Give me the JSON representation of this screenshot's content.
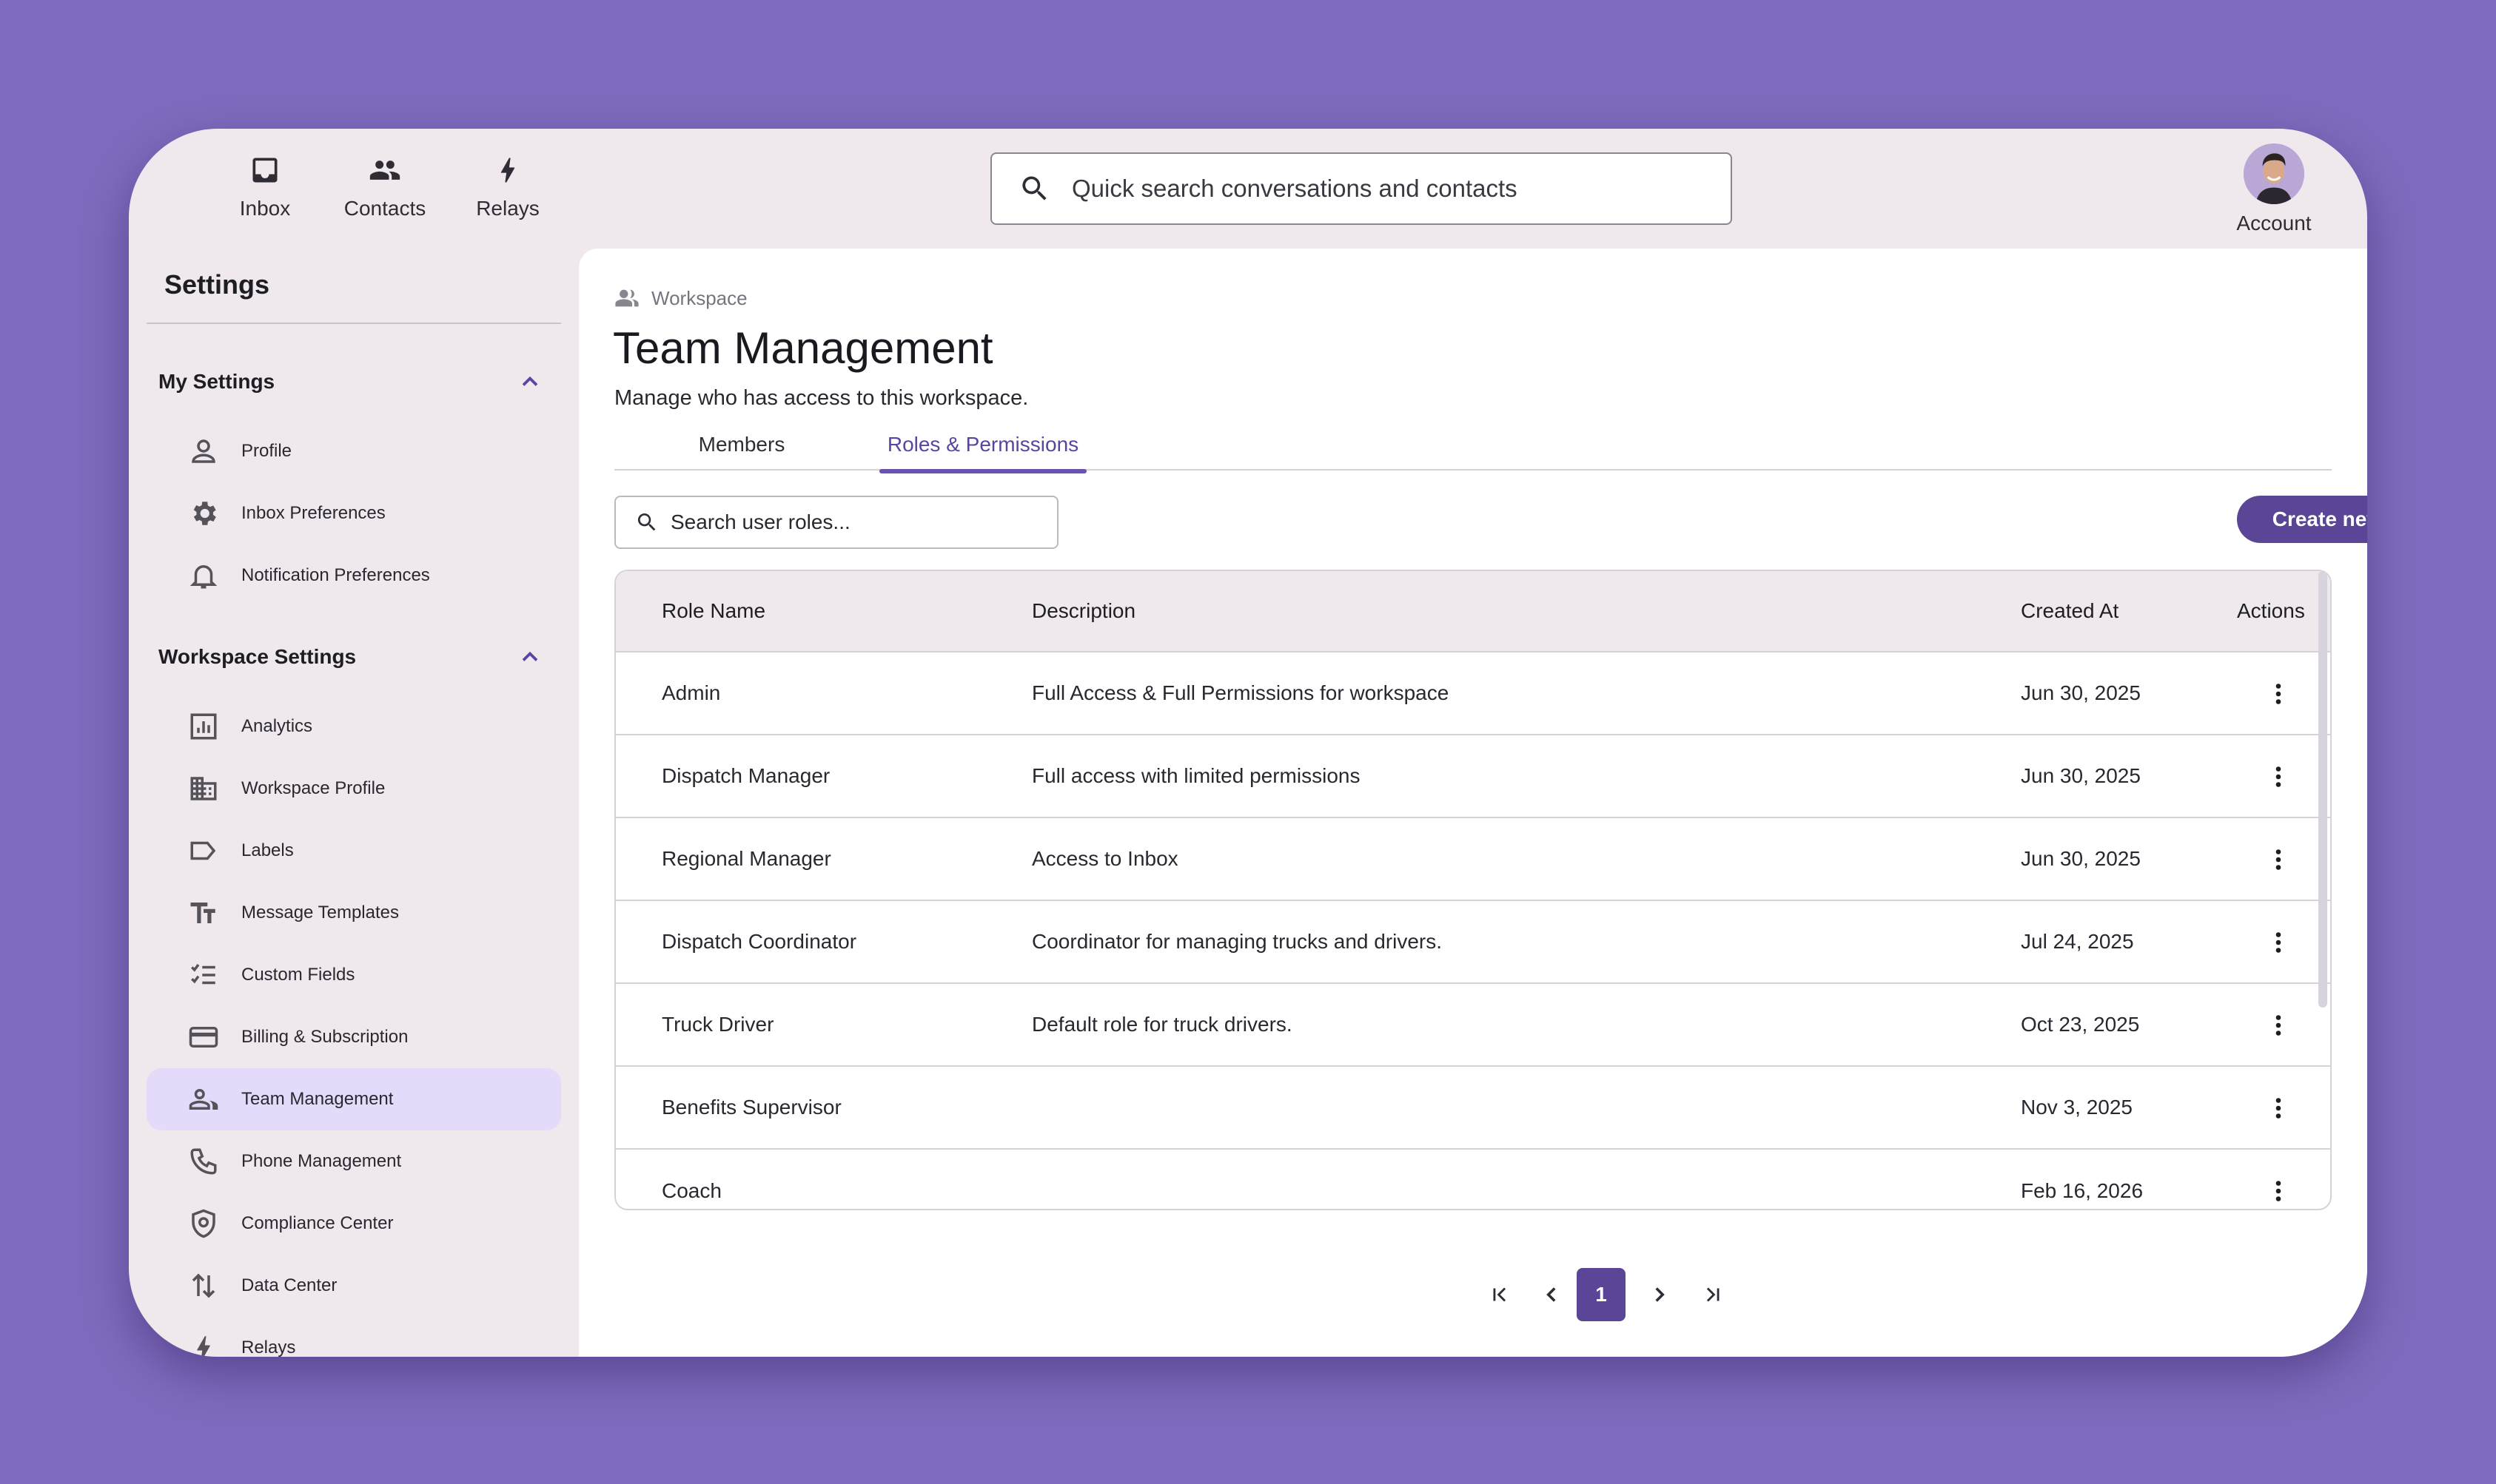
{
  "topnav": {
    "inbox_label": "Inbox",
    "contacts_label": "Contacts",
    "relays_label": "Relays",
    "search_placeholder": "Quick search conversations and contacts",
    "account_label": "Account"
  },
  "sidebar": {
    "title": "Settings",
    "my_settings": {
      "label": "My Settings",
      "items": [
        {
          "label": "Profile",
          "icon": "person-icon"
        },
        {
          "label": "Inbox Preferences",
          "icon": "gear-icon"
        },
        {
          "label": "Notification Preferences",
          "icon": "bell-icon"
        }
      ]
    },
    "workspace_settings": {
      "label": "Workspace Settings",
      "items": [
        {
          "label": "Analytics",
          "icon": "analytics-icon"
        },
        {
          "label": "Workspace Profile",
          "icon": "building-icon"
        },
        {
          "label": "Labels",
          "icon": "label-icon"
        },
        {
          "label": "Message Templates",
          "icon": "text-size-icon"
        },
        {
          "label": "Custom Fields",
          "icon": "checklist-icon"
        },
        {
          "label": "Billing & Subscription",
          "icon": "credit-card-icon"
        },
        {
          "label": "Team Management",
          "icon": "team-icon",
          "active": true
        },
        {
          "label": "Phone Management",
          "icon": "phone-icon"
        },
        {
          "label": "Compliance Center",
          "icon": "shield-icon"
        },
        {
          "label": "Data Center",
          "icon": "transfer-icon"
        },
        {
          "label": "Relays",
          "icon": "bolt-icon"
        }
      ]
    }
  },
  "main": {
    "breadcrumb": "Workspace",
    "title": "Team Management",
    "subtitle": "Manage who has access to this workspace.",
    "tabs": [
      {
        "label": "Members"
      },
      {
        "label": "Roles & Permissions",
        "active": true
      }
    ],
    "role_search_placeholder": "Search user roles...",
    "create_button": "Create new role",
    "table": {
      "headers": {
        "name": "Role Name",
        "description": "Description",
        "created": "Created At",
        "actions": "Actions"
      },
      "rows": [
        {
          "name": "Admin",
          "description": "Full Access & Full Permissions for workspace",
          "created": "Jun 30, 2025"
        },
        {
          "name": "Dispatch Manager",
          "description": "Full access with limited permissions",
          "created": "Jun 30, 2025"
        },
        {
          "name": "Regional Manager",
          "description": "Access to Inbox",
          "created": "Jun 30, 2025"
        },
        {
          "name": "Dispatch Coordinator",
          "description": "Coordinator for managing trucks and drivers.",
          "created": "Jul 24, 2025"
        },
        {
          "name": "Truck Driver",
          "description": "Default role for truck drivers.",
          "created": "Oct 23, 2025"
        },
        {
          "name": "Benefits Supervisor",
          "description": "",
          "created": "Nov 3, 2025"
        },
        {
          "name": "Coach",
          "description": "",
          "created": "Feb 16, 2026"
        }
      ]
    },
    "pagination": {
      "current_page": "1"
    }
  },
  "colors": {
    "background": "#7e6bbd",
    "accent": "#5a4596",
    "active_nav": "#e4dbfa"
  }
}
